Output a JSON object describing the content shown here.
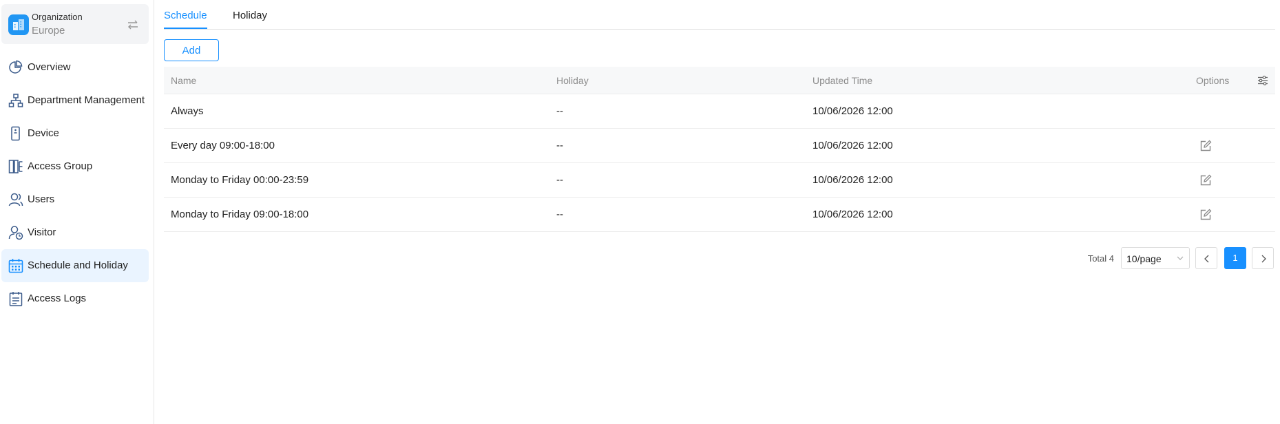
{
  "organization": {
    "label": "Organization",
    "name": "Europe"
  },
  "sidebar": {
    "items": [
      {
        "label": "Overview",
        "icon": "pie-chart-icon"
      },
      {
        "label": "Department Management",
        "icon": "org-tree-icon"
      },
      {
        "label": "Device",
        "icon": "device-icon"
      },
      {
        "label": "Access Group",
        "icon": "access-group-icon"
      },
      {
        "label": "Users",
        "icon": "users-icon"
      },
      {
        "label": "Visitor",
        "icon": "visitor-icon"
      },
      {
        "label": "Schedule and Holiday",
        "icon": "calendar-icon",
        "active": true
      },
      {
        "label": "Access Logs",
        "icon": "logs-icon"
      }
    ]
  },
  "tabs": [
    {
      "label": "Schedule",
      "active": true
    },
    {
      "label": "Holiday",
      "active": false
    }
  ],
  "toolbar": {
    "add_label": "Add"
  },
  "table": {
    "columns": {
      "name": "Name",
      "holiday": "Holiday",
      "updated_time": "Updated Time",
      "options": "Options"
    },
    "rows": [
      {
        "name": "Always",
        "holiday": "--",
        "updated_time": "10/06/2026 12:00",
        "editable": false
      },
      {
        "name": "Every day 09:00-18:00",
        "holiday": "--",
        "updated_time": "10/06/2026 12:00",
        "editable": true
      },
      {
        "name": "Monday to Friday 00:00-23:59",
        "holiday": "--",
        "updated_time": "10/06/2026 12:00",
        "editable": true
      },
      {
        "name": "Monday to Friday 09:00-18:00",
        "holiday": "--",
        "updated_time": "10/06/2026 12:00",
        "editable": true
      }
    ]
  },
  "pagination": {
    "total_label": "Total 4",
    "page_size": "10/page",
    "current_page": "1"
  },
  "colors": {
    "accent": "#1890ff",
    "active_nav_bg": "#eaf4ff",
    "org_logo": "#2196f3"
  }
}
